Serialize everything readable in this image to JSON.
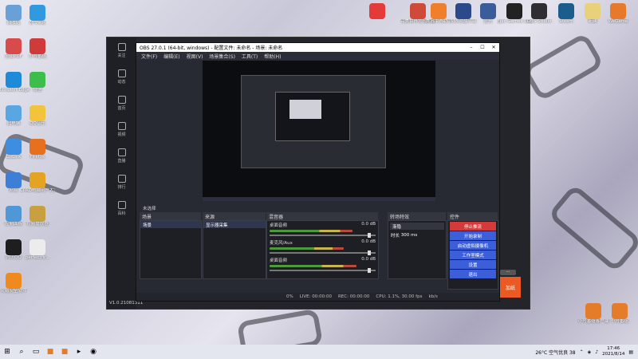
{
  "desktop_left_icons": [
    {
      "label": "回收站",
      "icon": "recycle-bin-icon",
      "color": "#6aa0d8"
    },
    {
      "label": "命令e驾",
      "icon": "edge-icon",
      "color": "#2f9ae0"
    },
    {
      "label": "金山PDF",
      "icon": "pdf-icon",
      "color": "#d94a4a"
    },
    {
      "label": "小号番组",
      "icon": "app-icon",
      "color": "#cf3a3a"
    },
    {
      "label": "Microsoft Edge",
      "icon": "edge-icon",
      "color": "#1f8ad8"
    },
    {
      "label": "微信",
      "icon": "wechat-icon",
      "color": "#3cbf4a"
    },
    {
      "label": "此电脑",
      "icon": "computer-icon",
      "color": "#5aa6e2"
    },
    {
      "label": "QQ音乐",
      "icon": "qq-music-icon",
      "color": "#f2c43b"
    },
    {
      "label": "GoLink",
      "icon": "golink-icon",
      "color": "#3d8ee0"
    },
    {
      "label": "Firefox",
      "icon": "firefox-icon",
      "color": "#e6701f"
    },
    {
      "label": "网易",
      "icon": "netease-icon",
      "color": "#3d7fd6"
    },
    {
      "label": "CPAD电脑用户大区",
      "icon": "game-icon",
      "color": "#e4a323"
    },
    {
      "label": "控制面板",
      "icon": "control-panel-icon",
      "color": "#5097d8"
    },
    {
      "label": "视频播放器",
      "icon": "player-icon",
      "color": "#c8a040"
    },
    {
      "label": "腾讯QQ",
      "icon": "qq-icon",
      "color": "#1e1e1e"
    },
    {
      "label": "perfectfir...",
      "icon": "file-icon",
      "color": "#ececec"
    },
    {
      "label": "火绒安全软件",
      "icon": "security-icon",
      "color": "#ef8a1e"
    }
  ],
  "desktop_top_icons": [
    {
      "label": "",
      "icon": "tshirt-icon",
      "color": "#e63a3a"
    },
    {
      "label": "完美世界竞技平台",
      "icon": "perfect-world-icon",
      "color": "#d04a3a"
    },
    {
      "label": "腾讯手游助手",
      "icon": "tencent-emulator-icon",
      "color": "#f07f2c"
    },
    {
      "label": "555对战平台",
      "icon": "battle-platform-icon",
      "color": "#2c4a8a"
    },
    {
      "label": "蓝光",
      "icon": "bluray-icon",
      "color": "#3b5c9a"
    },
    {
      "label": "Epic Games Launcher",
      "icon": "epic-icon",
      "color": "#222"
    },
    {
      "label": "OBS Studio",
      "icon": "obs-icon",
      "color": "#302e33"
    },
    {
      "label": "Steam",
      "icon": "steam-icon",
      "color": "#1b5d8c"
    },
    {
      "label": "新建",
      "icon": "folder-icon",
      "color": "#e8d17a"
    },
    {
      "label": "WeGame",
      "icon": "wegame-icon",
      "color": "#e77a2a"
    }
  ],
  "desktop_bottom_right_icons": [
    {
      "label": "小号番组客户端",
      "icon": "app-icon",
      "color": "#e57c2a"
    },
    {
      "label": "小号番组",
      "icon": "app-icon",
      "color": "#e57c2a"
    }
  ],
  "obs": {
    "title": "OBS 27.0.1 (64-bit, windows) - 配置文件: 未命名 - 场景: 未命名",
    "menu": [
      "文件(F)",
      "编辑(E)",
      "视图(V)",
      "场景集合(S)",
      "工具(T)",
      "帮助(H)"
    ],
    "side_items": [
      "关注",
      "动态",
      "首页",
      "视频",
      "直播",
      "排行",
      "百科"
    ],
    "scene_status": "未选择",
    "panels": {
      "scenes": "场景",
      "sources": "来源",
      "mixer": "混音器",
      "transitions": "转场特效",
      "controls": "控件"
    },
    "scene_list": [
      "场景"
    ],
    "source_list": [
      "显示器采集"
    ],
    "mixer_channels": [
      {
        "name": "桌面音频",
        "level": "0.0 dB",
        "fill": 0.78
      },
      {
        "name": "麦克风/Aux",
        "level": "0.0 dB",
        "fill": 0.7
      },
      {
        "name": "桌面音频",
        "level": "0.0 dB",
        "fill": 0.82
      }
    ],
    "transition": {
      "type": "渐隐",
      "duration_label": "时长",
      "duration": "300 ms"
    },
    "controls": [
      "停止推流",
      "开始录制",
      "启动虚拟摄像机",
      "工作室模式",
      "设置",
      "退出"
    ],
    "status": {
      "dropped": "0%",
      "live": "LIVE: 00:00:00",
      "rec": "REC: 00:00:00",
      "cpu": "CPU: 1.1%, 30.00 fps",
      "kbps": "kb/s"
    },
    "version": "V1.0.21081311",
    "corner_button": "加纸"
  },
  "taskbar": {
    "weather": "26°C 空气优良 38",
    "time": "17:46",
    "date": "2021/8/14"
  }
}
